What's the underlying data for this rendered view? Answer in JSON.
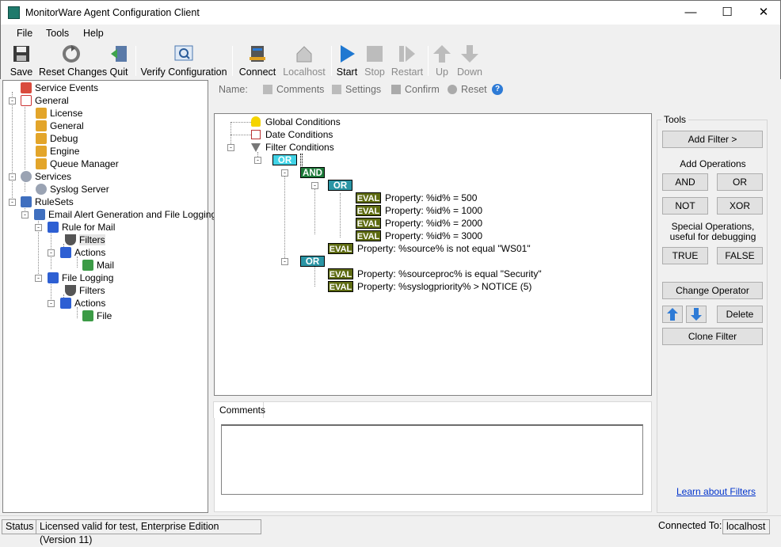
{
  "window": {
    "title": "MonitorWare Agent Configuration Client"
  },
  "menu": [
    "File",
    "Tools",
    "Help"
  ],
  "toolbar": {
    "save": "Save",
    "reset_changes": "Reset Changes",
    "quit": "Quit",
    "verify": "Verify Configuration",
    "connect": "Connect",
    "localhost": "Localhost",
    "start": "Start",
    "stop": "Stop",
    "restart": "Restart",
    "up": "Up",
    "down": "Down"
  },
  "tree": {
    "service_events": "Service Events",
    "general": "General",
    "license": "License",
    "general_child": "General",
    "debug": "Debug",
    "engine": "Engine",
    "queue_manager": "Queue Manager",
    "services": "Services",
    "syslog_server": "Syslog Server",
    "rulesets": "RuleSets",
    "ruleset_email": "Email Alert Generation and File Logging",
    "rule_mail": "Rule for Mail",
    "filters1": "Filters",
    "actions1": "Actions",
    "mail": "Mail",
    "rule_file": "File Logging",
    "filters2": "Filters",
    "actions2": "Actions",
    "file": "File"
  },
  "subbar": {
    "name": "Name:",
    "comments": "Comments",
    "settings": "Settings",
    "confirm": "Confirm",
    "reset": "Reset"
  },
  "filter": {
    "global": "Global Conditions",
    "date": "Date Conditions",
    "filter_conditions": "Filter Conditions",
    "or_top": "OR",
    "and": "AND",
    "or_inner": "OR",
    "or_bottom": "OR",
    "eval": "EVAL",
    "e1": "Property: %id% = 500",
    "e2": "Property: %id% = 1000",
    "e3": "Property: %id% = 2000",
    "e4": "Property: %id% = 3000",
    "e5": "Property: %source% is not equal \"WS01\"",
    "e6": "Property: %sourceproc% is equal \"Security\"",
    "e7": "Property: %syslogpriority% >  NOTICE (5)"
  },
  "comments": {
    "tab": "Comments",
    "value": ""
  },
  "tools": {
    "legend": "Tools",
    "add_filter": "Add Filter >",
    "add_operations": "Add Operations",
    "and": "AND",
    "or": "OR",
    "not": "NOT",
    "xor": "XOR",
    "special_1": "Special Operations,",
    "special_2": "useful for debugging",
    "true": "TRUE",
    "false": "FALSE",
    "change_operator": "Change Operator",
    "delete": "Delete",
    "clone_filter": "Clone Filter",
    "learn": "Learn about Filters"
  },
  "status": {
    "label": "Status",
    "license": "Licensed valid for test, Enterprise Edition (Version 11)",
    "connected_label": "Connected To:",
    "host": "localhost"
  }
}
